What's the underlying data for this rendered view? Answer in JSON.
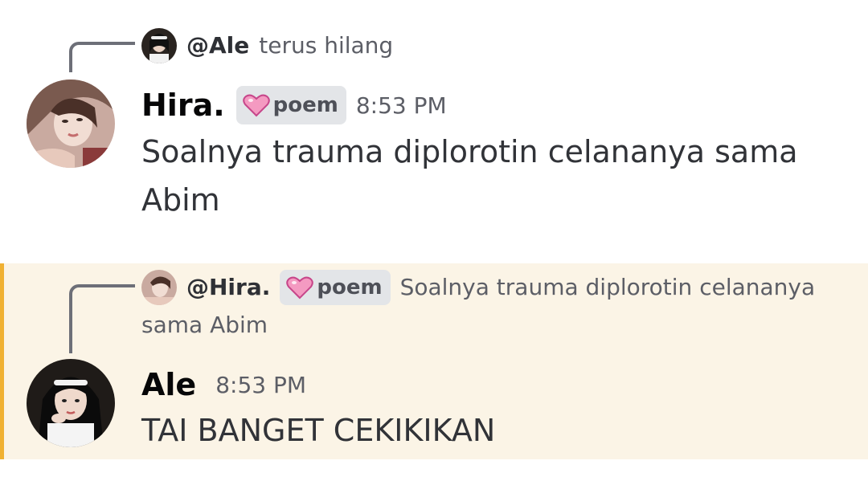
{
  "messages": [
    {
      "reply_to": {
        "name": "@Ale",
        "text": "terus hilang"
      },
      "author": "Hira.",
      "tag": "poem",
      "time": "8:53 PM",
      "text": "Soalnya trauma diplorotin celananya sama Abim"
    },
    {
      "reply_to": {
        "name": "@Hira.",
        "tag": "poem",
        "text": "Soalnya trauma diplorotin celananya",
        "text_cont": "sama Abim"
      },
      "author": "Ale",
      "time": "8:53 PM",
      "text": "TAI BANGET CEKIKIKAN",
      "mention_color": "#f0b132",
      "highlight_bg": "#fbf4e6"
    }
  ]
}
